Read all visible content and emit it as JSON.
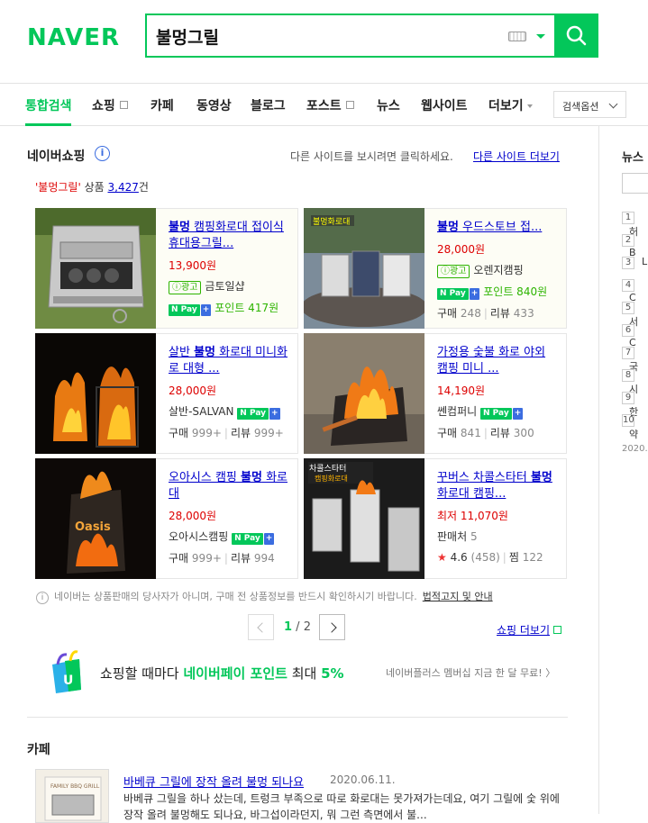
{
  "header": {
    "logo": "NAVER",
    "search_value": "불멍그릴"
  },
  "tabs": [
    {
      "label": "통합검색",
      "active": true
    },
    {
      "label": "쇼핑",
      "external": true
    },
    {
      "label": "카페"
    },
    {
      "label": "동영상"
    },
    {
      "label": "블로그"
    },
    {
      "label": "포스트",
      "external": true
    },
    {
      "label": "뉴스"
    },
    {
      "label": "웹사이트"
    },
    {
      "label": "더보기"
    }
  ],
  "search_options": "검색옵션",
  "shopping": {
    "title": "네이버쇼핑",
    "other_site_text": "다른 사이트를 보시려면 클릭하세요.",
    "other_site_link": "다른 사이트 더보기",
    "query": "'불멍그릴'",
    "count_label": "상품",
    "count": "3,427",
    "count_suffix": "건",
    "products": [
      {
        "title_bold": "불멍",
        "title": " 캠핑화로대 접이식 휴대용그릴...",
        "price": "13,900원",
        "ad": "광고",
        "seller": "금토일샵",
        "npay": "Pay",
        "point": "포인트 417원"
      },
      {
        "title_bold": "불멍",
        "title": " 우드스토브 접...",
        "price": "28,000원",
        "ad": "광고",
        "seller": "오렌지캠핑",
        "npay": "Pay",
        "point": "포인트 840원",
        "buy": "구매",
        "buy_count": "248",
        "review": "리뷰",
        "review_count": "433"
      },
      {
        "title_pre": "살반 ",
        "title_bold": "불멍",
        "title": " 화로대 미니화로 대형 ...",
        "price": "28,000원",
        "seller": "살반-SALVAN",
        "npay": "Pay",
        "buy": "구매",
        "buy_count": "999+",
        "review": "리뷰",
        "review_count": "999+"
      },
      {
        "title": "가정용 숯불 화로 야외 캠핑 미니 ...",
        "price": "14,190원",
        "seller": "쎈컴퍼니",
        "npay": "Pay",
        "buy": "구매",
        "buy_count": "841",
        "review": "리뷰",
        "review_count": "300"
      },
      {
        "title_pre": "오아시스 캠핑 ",
        "title_bold": "불멍",
        "title": " 화로대",
        "price": "28,000원",
        "seller": "오아시스캠핑",
        "npay": "Pay",
        "buy": "구매",
        "buy_count": "999+",
        "review": "리뷰",
        "review_count": "994"
      },
      {
        "title_pre": "꾸버스 차콜스타터 ",
        "title_bold": "불멍",
        "title": "화로대 캠핑...",
        "price": "최저 11,070원",
        "seller_label": "판매처",
        "seller_count": "5",
        "rating": "4.6",
        "rating_count": "(458)",
        "zzim": "찜",
        "zzim_count": "122"
      }
    ],
    "notice": "네이버는 상품판매의 당사자가 아니며, 구매 전 상품정보를 반드시 확인하시기 바랍니다.",
    "notice_link": "법적고지 및 안내",
    "page_current": "1",
    "page_total": "2",
    "more": "쇼핑 더보기"
  },
  "banner": {
    "text_a": "쇼핑할 때마다 ",
    "text_b": "네이버페이 포인트",
    "text_c": " 최대 ",
    "text_d": "5%",
    "sub": "네이버플러스 멤버십 지금 한 달 무료! 〉"
  },
  "cafe": {
    "title": "카페",
    "link": "바베큐 그릴에 장작 올려 불멍 되나요",
    "date": "2020.06.11.",
    "desc": "바베큐 그릴을 하나 샀는데, 트렁크 부족으로 따로 화로대는 못가져가는데요, 여기 그릴에 숯 위에 장작 올려 불멍해도 되나요, 바그섭이라던지, 뭐 그런 측면에서 불..."
  },
  "sidebar": {
    "title": "뉴스",
    "ranks": [
      {
        "n": "1",
        "t": "허"
      },
      {
        "n": "2",
        "t": "B"
      },
      {
        "n": "3",
        "t": "L"
      },
      {
        "n": "4",
        "t": "C"
      },
      {
        "n": "5",
        "t": "서"
      },
      {
        "n": "6",
        "t": "C"
      },
      {
        "n": "7",
        "t": "국"
      },
      {
        "n": "8",
        "t": "시"
      },
      {
        "n": "9",
        "t": "한"
      },
      {
        "n": "10",
        "t": "약"
      }
    ],
    "date": "2020.0"
  }
}
